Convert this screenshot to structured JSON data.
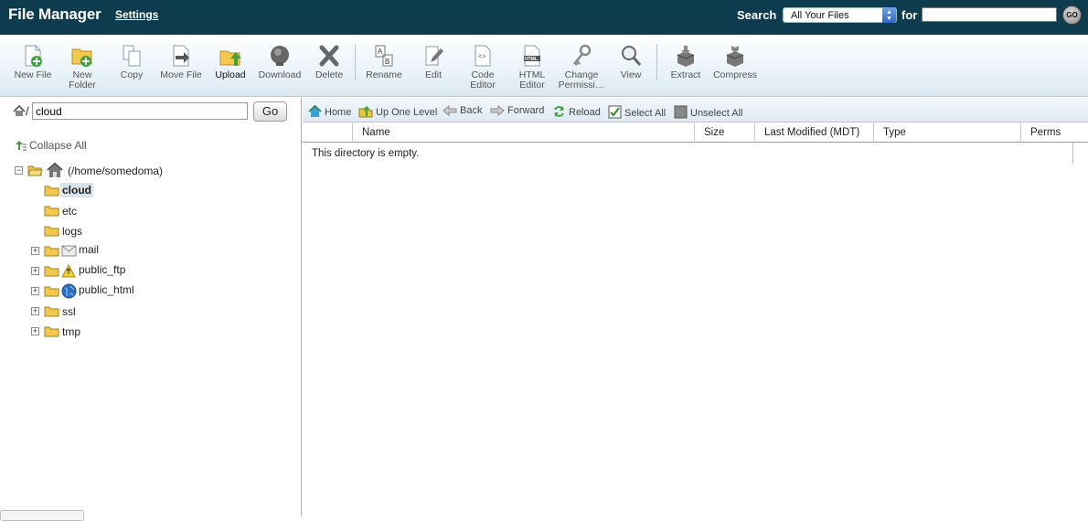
{
  "header": {
    "title": "File Manager",
    "settings_label": "Settings",
    "search_label": "Search",
    "search_scope": "All Your Files",
    "for_label": "for",
    "search_query": "",
    "go_label": "GO"
  },
  "toolbar": {
    "new_file": "New File",
    "new_folder": "New Folder",
    "copy": "Copy",
    "move_file": "Move File",
    "upload": "Upload",
    "download": "Download",
    "delete": "Delete",
    "rename": "Rename",
    "edit": "Edit",
    "code_editor": "Code Editor",
    "html_editor": "HTML Editor",
    "change_permissions": "Change Permissi…",
    "view": "View",
    "extract": "Extract",
    "compress": "Compress"
  },
  "sidebar": {
    "path_value": "cloud",
    "go_label": "Go",
    "collapse_all": "Collapse All",
    "root_label": "(/home/somedoma)",
    "items": [
      {
        "label": "cloud"
      },
      {
        "label": "etc"
      },
      {
        "label": "logs"
      },
      {
        "label": "mail"
      },
      {
        "label": "public_ftp"
      },
      {
        "label": "public_html"
      },
      {
        "label": "ssl"
      },
      {
        "label": "tmp"
      }
    ]
  },
  "nav": {
    "home": "Home",
    "up_one_level": "Up One Level",
    "back": "Back",
    "forward": "Forward",
    "reload": "Reload",
    "select_all": "Select All",
    "unselect_all": "Unselect All"
  },
  "grid": {
    "columns": [
      "Name",
      "Size",
      "Last Modified (MDT)",
      "Type",
      "Perms"
    ],
    "empty_message": "This directory is empty."
  }
}
